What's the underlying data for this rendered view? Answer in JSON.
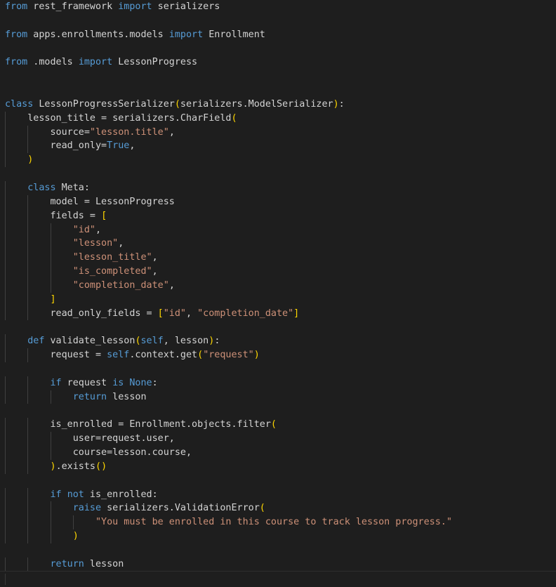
{
  "editor": {
    "language": "python",
    "theme_colors": {
      "background": "#1e1e1e",
      "text": "#d4d4d4",
      "keyword": "#569cd6",
      "string": "#ce9178",
      "bracket": "#ffd700"
    },
    "lines": [
      "from rest_framework import serializers",
      "",
      "from apps.enrollments.models import Enrollment",
      "",
      "from .models import LessonProgress",
      "",
      "",
      "class LessonProgressSerializer(serializers.ModelSerializer):",
      "    lesson_title = serializers.CharField(",
      "        source=\"lesson.title\",",
      "        read_only=True,",
      "    )",
      "",
      "    class Meta:",
      "        model = LessonProgress",
      "        fields = [",
      "            \"id\",",
      "            \"lesson\",",
      "            \"lesson_title\",",
      "            \"is_completed\",",
      "            \"completion_date\",",
      "        ]",
      "        read_only_fields = [\"id\", \"completion_date\"]",
      "",
      "    def validate_lesson(self, lesson):",
      "        request = self.context.get(\"request\")",
      "",
      "        if request is None:",
      "            return lesson",
      "",
      "        is_enrolled = Enrollment.objects.filter(",
      "            user=request.user,",
      "            course=lesson.course,",
      "        ).exists()",
      "",
      "        if not is_enrolled:",
      "            raise serializers.ValidationError(",
      "                \"You must be enrolled in this course to track lesson progress.\"",
      "            )",
      "",
      "        return lesson"
    ]
  }
}
